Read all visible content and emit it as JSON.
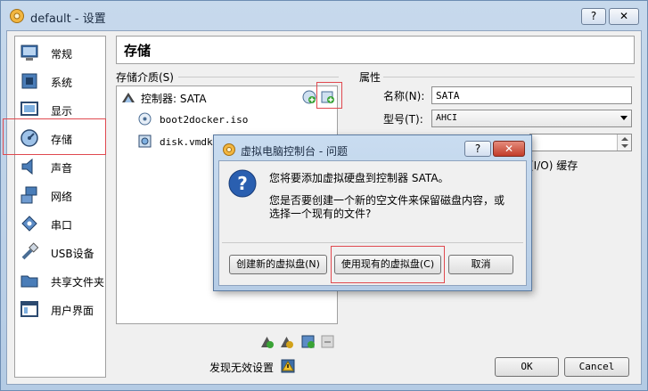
{
  "window": {
    "title": "default - 设置",
    "help_label": "?",
    "close_label": "✕"
  },
  "sidebar": {
    "items": [
      {
        "label": "常规"
      },
      {
        "label": "系统"
      },
      {
        "label": "显示"
      },
      {
        "label": "存储"
      },
      {
        "label": "声音"
      },
      {
        "label": "网络"
      },
      {
        "label": "串口"
      },
      {
        "label": "USB设备"
      },
      {
        "label": "共享文件夹"
      },
      {
        "label": "用户界面"
      }
    ],
    "selected_index": 3
  },
  "page": {
    "title": "存储"
  },
  "storage": {
    "section_label": "存储介质(S)",
    "controller_label": "控制器: SATA",
    "items": [
      {
        "label": "boot2docker.iso"
      },
      {
        "label": "disk.vmdk"
      }
    ]
  },
  "attributes": {
    "section_label": "属性",
    "name_label": "名称(N):",
    "name_value": "SATA",
    "type_label": "型号(T):",
    "type_value": "AHCI",
    "cache_label": "(I/O) 缓存"
  },
  "footer": {
    "invalid_label": "发现无效设置",
    "ok_label": "OK",
    "cancel_label": "Cancel"
  },
  "dialog": {
    "title": "虚拟电脑控制台 - 问题",
    "help_label": "?",
    "close_label": "✕",
    "message_1": "您将要添加虚拟硬盘到控制器 SATA。",
    "message_2": "您是否要创建一个新的空文件来保留磁盘内容，或",
    "message_3": "选择一个现有的文件?",
    "create_new_label": "创建新的虚拟盘(N)",
    "use_existing_label": "使用现有的虚拟盘(C)",
    "cancel_label": "取消"
  },
  "colors": {
    "highlight_box": "#e0494f",
    "title_gradient_top": "#c7d9ec",
    "accent_green": "#3aa336"
  }
}
